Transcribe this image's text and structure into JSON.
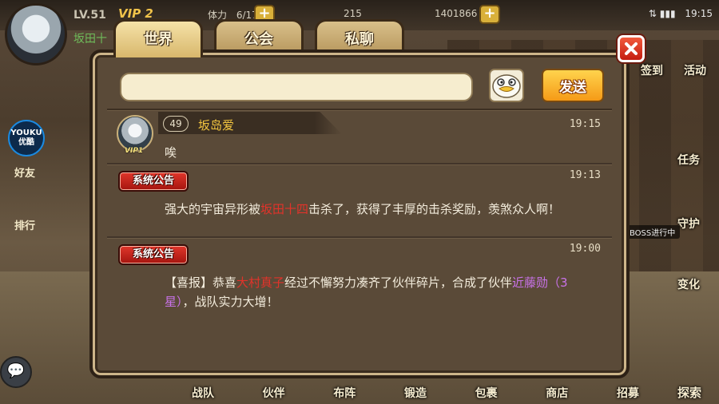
{
  "hud": {
    "level": "LV.51",
    "vip": "VIP 2",
    "player_name": "坂田十",
    "stamina_label": "体力",
    "stamina": "6/170",
    "coins": "215",
    "gems": "1401866",
    "status_time": "19:15"
  },
  "tabs": [
    {
      "label": "世界",
      "active": true
    },
    {
      "label": "公会",
      "active": false
    },
    {
      "label": "私聊",
      "active": false
    }
  ],
  "chat_input": {
    "value": "",
    "placeholder": ""
  },
  "send_label": "发送",
  "messages": [
    {
      "type": "player",
      "level": "49",
      "sender": "坂岛爱",
      "vip": "VIP1",
      "time": "19:15",
      "text": "唉"
    },
    {
      "type": "system",
      "badge": "系统公告",
      "time": "19:13",
      "parts": [
        "强大的宇宙异形被",
        "坂田十四",
        "击杀了，获得了丰厚的击杀奖励，羡煞众人啊！"
      ]
    },
    {
      "type": "system",
      "badge": "系统公告",
      "time": "19:00",
      "parts": [
        "【喜报】恭喜",
        "大村真子",
        "经过不懈努力凑齐了伙伴碎片，合成了伙伴",
        "近藤勋（3星）",
        "，战队实力大增！"
      ]
    }
  ],
  "side_left": [
    {
      "label": "好友"
    },
    {
      "label": "排行"
    }
  ],
  "youku_label": [
    "YOUKU",
    "优酷"
  ],
  "side_right": [
    {
      "label": "签到"
    },
    {
      "label": "活动"
    },
    {
      "label": "任务"
    },
    {
      "label": "守护"
    },
    {
      "label": "变化"
    }
  ],
  "boss_tag": "BOSS进行中",
  "bottom_nav": [
    "战队",
    "伙伴",
    "布阵",
    "锻造",
    "包裹",
    "商店",
    "招募"
  ],
  "explore_label": "探索",
  "colors": {
    "panel_bg": "#5a4a38",
    "tab_active": "#f5e2a8",
    "send_button": "#f59a17",
    "system_badge": "#c41d10",
    "name_gold": "#f1c43f",
    "highlight_red": "#e2332a",
    "highlight_purple": "#c872e8"
  }
}
